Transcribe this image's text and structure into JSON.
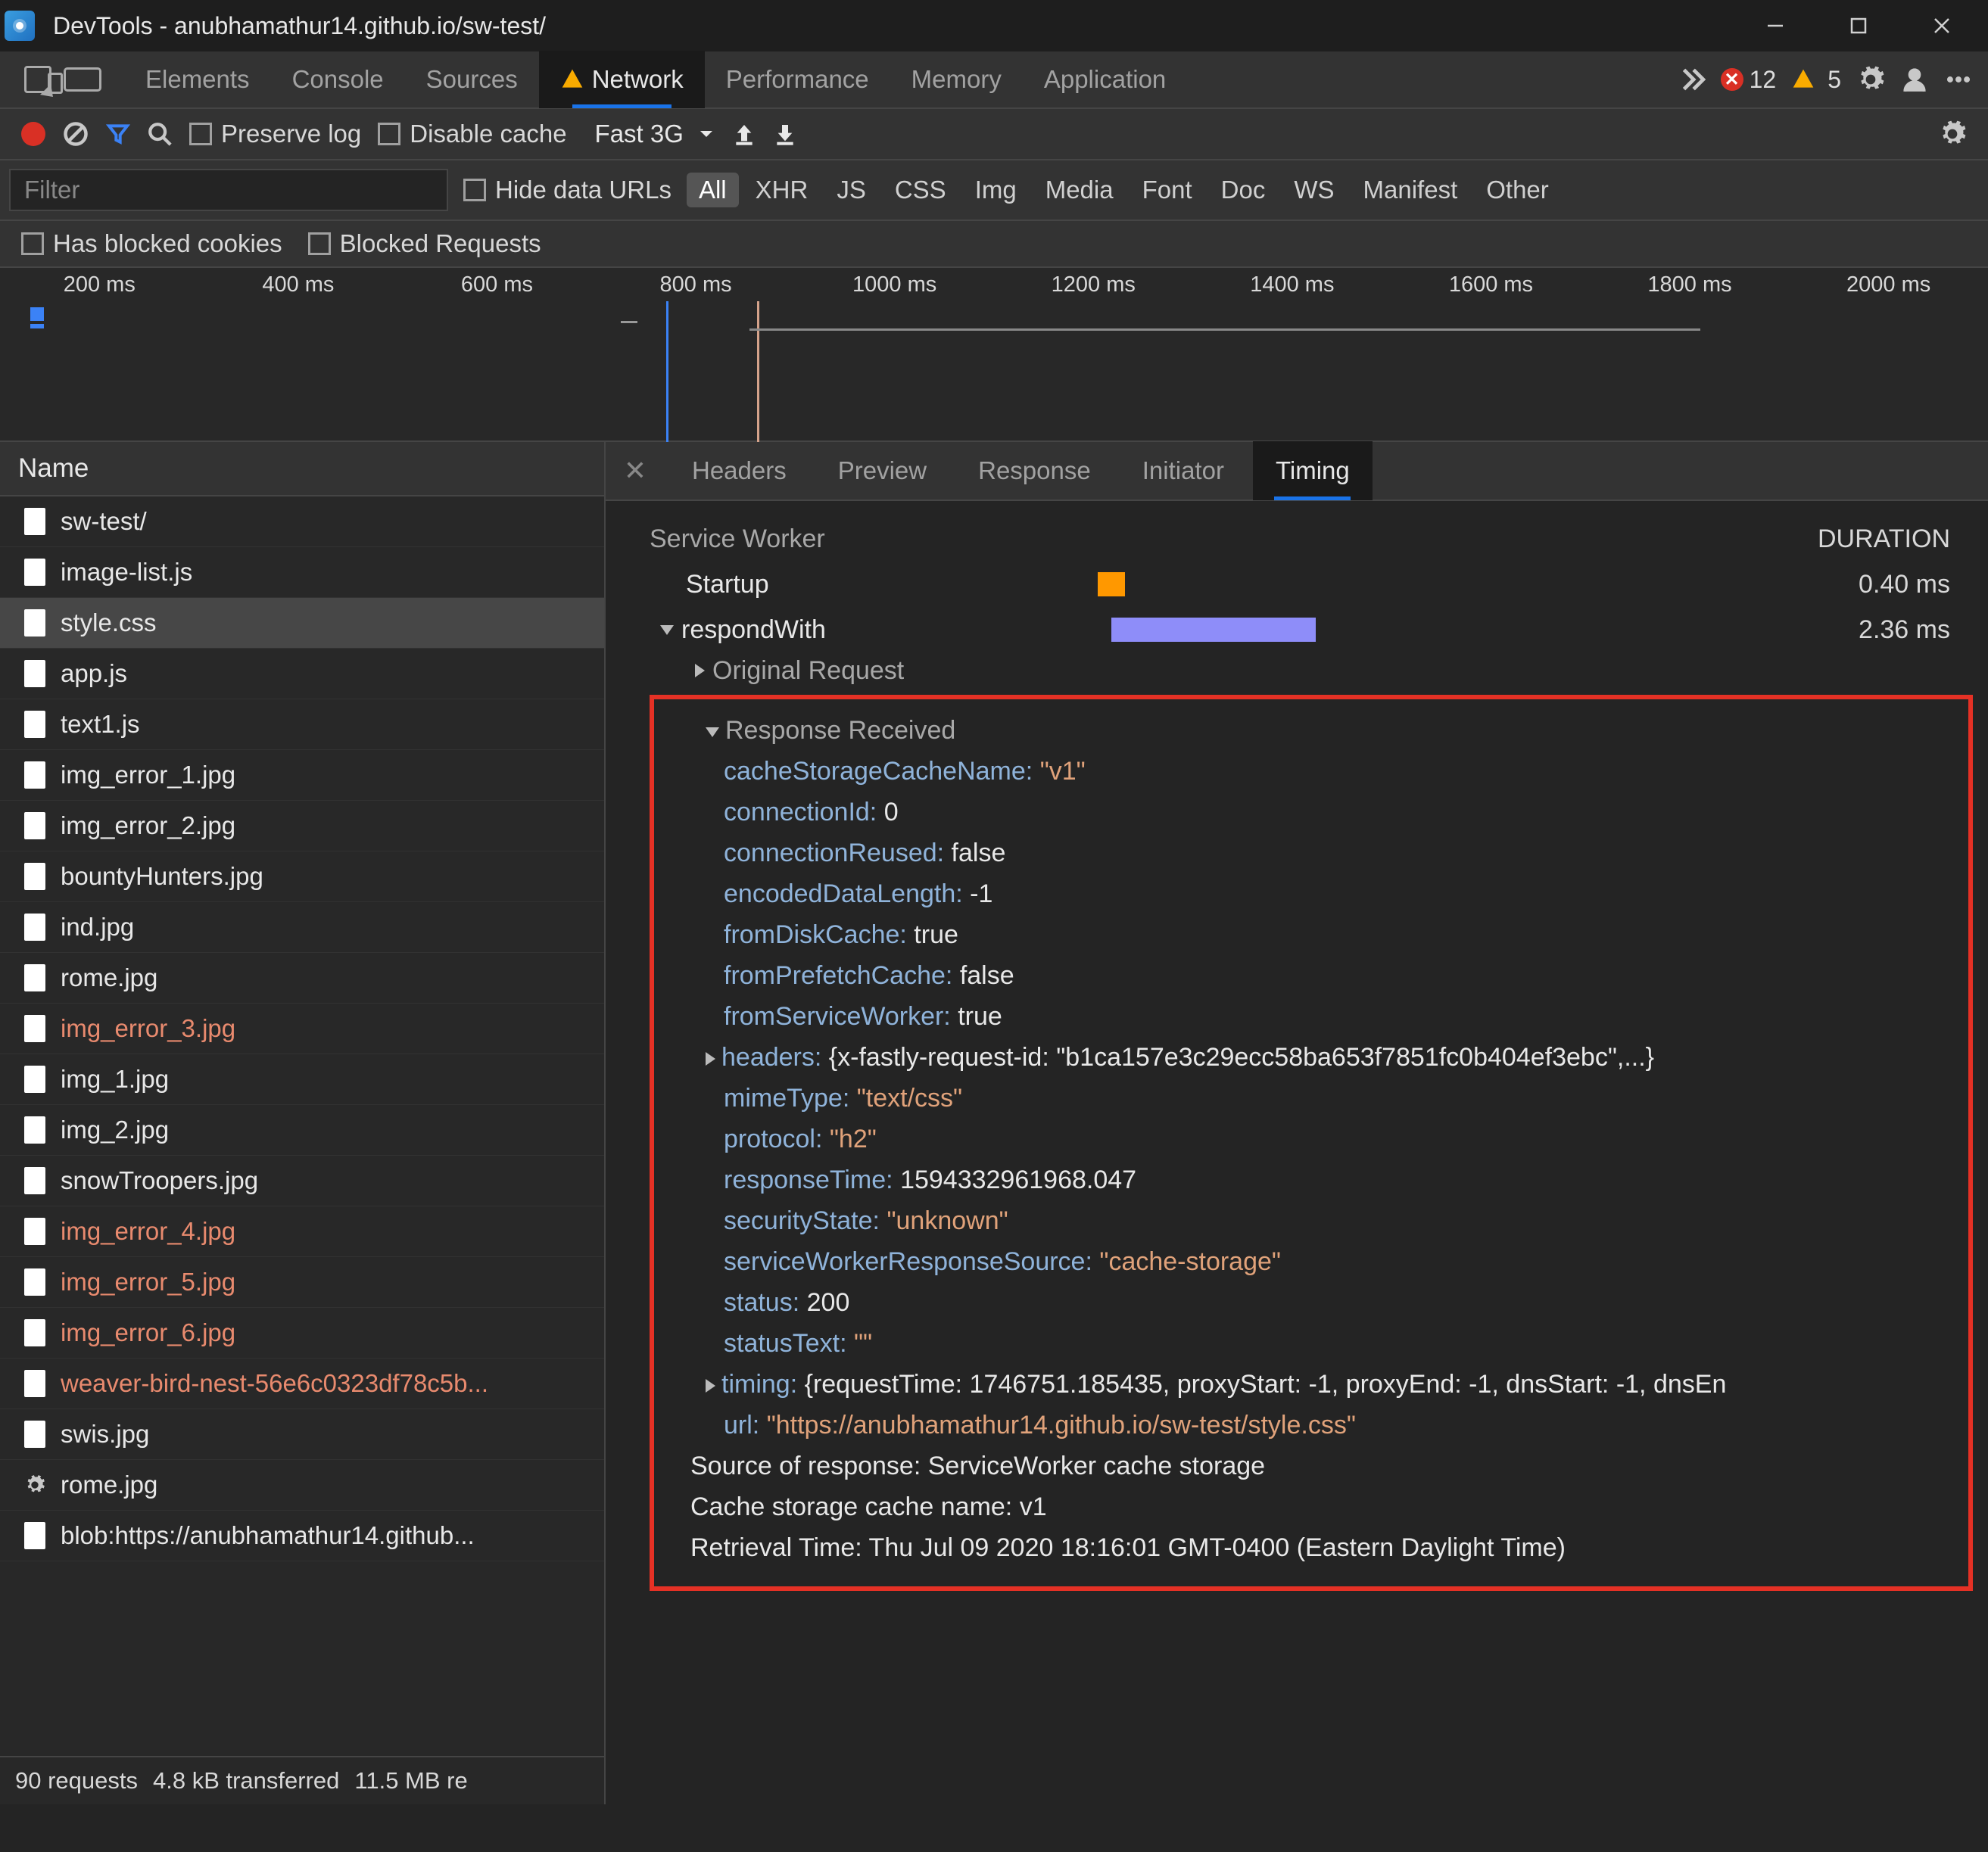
{
  "window": {
    "title": "DevTools - anubhamathur14.github.io/sw-test/"
  },
  "mainTabs": {
    "elements": "Elements",
    "console": "Console",
    "sources": "Sources",
    "network": "Network",
    "performance": "Performance",
    "memory": "Memory",
    "application": "Application"
  },
  "badges": {
    "errors": "12",
    "warnings": "5"
  },
  "toolbar": {
    "preserveLog": "Preserve log",
    "disableCache": "Disable cache",
    "throttle": "Fast 3G"
  },
  "filter": {
    "placeholder": "Filter",
    "hideDataUrls": "Hide data URLs",
    "types": [
      "All",
      "XHR",
      "JS",
      "CSS",
      "Img",
      "Media",
      "Font",
      "Doc",
      "WS",
      "Manifest",
      "Other"
    ],
    "hasBlocked": "Has blocked cookies",
    "blockedReq": "Blocked Requests"
  },
  "timeline": {
    "ticks": [
      "200 ms",
      "400 ms",
      "600 ms",
      "800 ms",
      "1000 ms",
      "1200 ms",
      "1400 ms",
      "1600 ms",
      "1800 ms",
      "2000 ms"
    ]
  },
  "nameHeader": "Name",
  "files": [
    {
      "name": "sw-test/",
      "err": false
    },
    {
      "name": "image-list.js",
      "err": false
    },
    {
      "name": "style.css",
      "err": false,
      "sel": true
    },
    {
      "name": "app.js",
      "err": false
    },
    {
      "name": "text1.js",
      "err": false
    },
    {
      "name": "img_error_1.jpg",
      "err": false
    },
    {
      "name": "img_error_2.jpg",
      "err": false
    },
    {
      "name": "bountyHunters.jpg",
      "err": false
    },
    {
      "name": "ind.jpg",
      "err": false
    },
    {
      "name": "rome.jpg",
      "err": false
    },
    {
      "name": "img_error_3.jpg",
      "err": true
    },
    {
      "name": "img_1.jpg",
      "err": false
    },
    {
      "name": "img_2.jpg",
      "err": false
    },
    {
      "name": "snowTroopers.jpg",
      "err": false
    },
    {
      "name": "img_error_4.jpg",
      "err": true
    },
    {
      "name": "img_error_5.jpg",
      "err": true
    },
    {
      "name": "img_error_6.jpg",
      "err": true
    },
    {
      "name": "weaver-bird-nest-56e6c0323df78c5b...",
      "err": true
    },
    {
      "name": "swis.jpg",
      "err": false
    },
    {
      "name": "rome.jpg",
      "err": false,
      "gear": true
    },
    {
      "name": "blob:https://anubhamathur14.github...",
      "err": false
    }
  ],
  "summary": {
    "requests": "90 requests",
    "transferred": "4.8 kB transferred",
    "resources": "11.5 MB re"
  },
  "detailTabs": {
    "headers": "Headers",
    "preview": "Preview",
    "response": "Response",
    "initiator": "Initiator",
    "timing": "Timing"
  },
  "timing": {
    "serviceWorker": "Service Worker",
    "duration": "DURATION",
    "startup": "Startup",
    "startupDur": "0.40 ms",
    "respondWith": "respondWith",
    "respondDur": "2.36 ms",
    "originalRequest": "Original Request",
    "responseReceived": "Response Received"
  },
  "props": {
    "cacheStorageCacheName": {
      "k": "cacheStorageCacheName:",
      "v": "\"v1\""
    },
    "connectionId": {
      "k": "connectionId:",
      "v": "0"
    },
    "connectionReused": {
      "k": "connectionReused:",
      "v": "false"
    },
    "encodedDataLength": {
      "k": "encodedDataLength:",
      "v": "-1"
    },
    "fromDiskCache": {
      "k": "fromDiskCache:",
      "v": "true"
    },
    "fromPrefetchCache": {
      "k": "fromPrefetchCache:",
      "v": "false"
    },
    "fromServiceWorker": {
      "k": "fromServiceWorker:",
      "v": "true"
    },
    "headers": {
      "k": "headers:",
      "v": "{x-fastly-request-id: \"b1ca157e3c29ecc58ba653f7851fc0b404ef3ebc\",...}"
    },
    "mimeType": {
      "k": "mimeType:",
      "v": "\"text/css\""
    },
    "protocol": {
      "k": "protocol:",
      "v": "\"h2\""
    },
    "responseTime": {
      "k": "responseTime:",
      "v": "1594332961968.047"
    },
    "securityState": {
      "k": "securityState:",
      "v": "\"unknown\""
    },
    "serviceWorkerResponseSource": {
      "k": "serviceWorkerResponseSource:",
      "v": "\"cache-storage\""
    },
    "status": {
      "k": "status:",
      "v": "200"
    },
    "statusText": {
      "k": "statusText:",
      "v": "\"\""
    },
    "timingProp": {
      "k": "timing:",
      "v": "{requestTime: 1746751.185435, proxyStart: -1, proxyEnd: -1, dnsStart: -1, dnsEn"
    },
    "url": {
      "k": "url:",
      "v": "\"https://anubhamathur14.github.io/sw-test/style.css\""
    }
  },
  "footer": {
    "source": "Source of response: ServiceWorker cache storage",
    "cacheName": "Cache storage cache name: v1",
    "retrieval": "Retrieval Time: Thu Jul 09 2020 18:16:01 GMT-0400 (Eastern Daylight Time)"
  }
}
